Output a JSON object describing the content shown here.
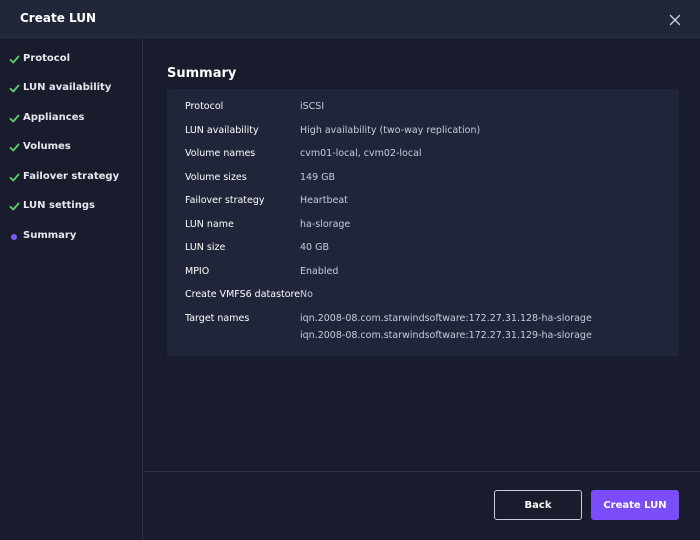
{
  "dialog": {
    "title": "Create LUN"
  },
  "steps": [
    {
      "label": "Protocol",
      "state": "done"
    },
    {
      "label": "LUN availability",
      "state": "done"
    },
    {
      "label": "Appliances",
      "state": "done"
    },
    {
      "label": "Volumes",
      "state": "done"
    },
    {
      "label": "Failover strategy",
      "state": "done"
    },
    {
      "label": "LUN settings",
      "state": "done"
    },
    {
      "label": "Summary",
      "state": "current"
    }
  ],
  "summary": {
    "title": "Summary",
    "rows": [
      {
        "key": "Protocol",
        "value": "iSCSI"
      },
      {
        "key": "LUN availability",
        "value": "High availability (two-way replication)"
      },
      {
        "key": "Volume names",
        "value": "cvm01-local, cvm02-local"
      },
      {
        "key": "Volume sizes",
        "value": "149 GB"
      },
      {
        "key": "Failover strategy",
        "value": "Heartbeat"
      },
      {
        "key": "LUN name",
        "value": "ha-slorage"
      },
      {
        "key": "LUN size",
        "value": "40 GB"
      },
      {
        "key": "MPIO",
        "value": "Enabled"
      },
      {
        "key": "Create VMFS6 datastore",
        "value": "No"
      }
    ],
    "target_names_label": "Target names",
    "target_names": [
      "iqn.2008-08.com.starwindsoftware:172.27.31.128-ha-slorage",
      "iqn.2008-08.com.starwindsoftware:172.27.31.129-ha-slorage"
    ]
  },
  "footer": {
    "back_label": "Back",
    "create_label": "Create LUN"
  },
  "colors": {
    "accent": "#7b4dfa",
    "check": "#5ccf6b",
    "current_dot": "#7b5cf5"
  },
  "icons": {
    "close": "close-icon",
    "done": "checkmark-icon",
    "current": "current-step-dot"
  }
}
